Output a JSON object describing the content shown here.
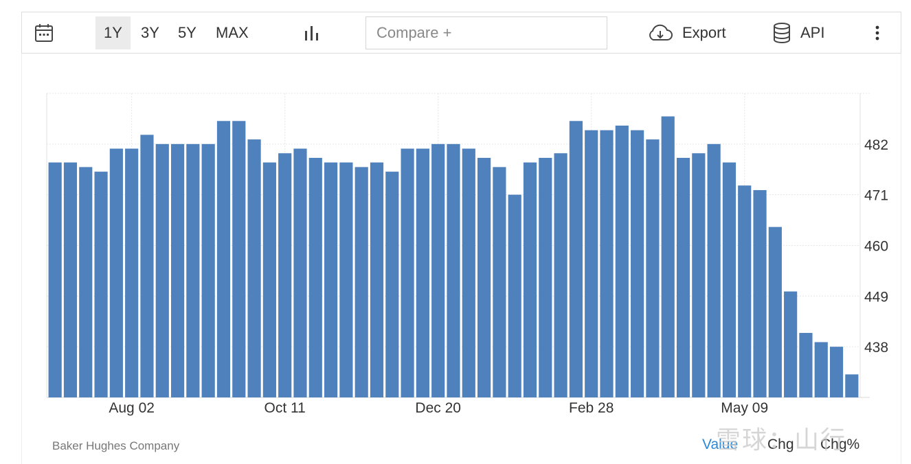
{
  "toolbar": {
    "calendar_icon": "calendar-icon",
    "ranges": [
      "1Y",
      "3Y",
      "5Y",
      "MAX"
    ],
    "active_range": "1Y",
    "chart_type_icon": "bar-chart-icon",
    "compare_placeholder": "Compare +",
    "export_label": "Export",
    "export_icon": "cloud-download-icon",
    "api_label": "API",
    "api_icon": "database-icon",
    "more_icon": "more-vertical-icon"
  },
  "source": "Baker Hughes Company",
  "footer_tabs": {
    "value": "Value",
    "chg": "Chg",
    "chg_pct": "Chg%",
    "active": "Value"
  },
  "watermark": "雪球：山行",
  "colors": {
    "bar": "#4f81bd",
    "active_tab": "#2b88d8",
    "grid": "#e6e6e6"
  },
  "chart_data": {
    "type": "bar",
    "title": "",
    "xlabel": "",
    "ylabel": "",
    "x_tick_labels": [
      "Aug 02",
      "Oct 11",
      "Dec 20",
      "Feb 28",
      "May 09"
    ],
    "y_tick_labels": [
      "438",
      "449",
      "460",
      "471",
      "482"
    ],
    "ylim": [
      427,
      493
    ],
    "grid": true,
    "y_axis_position": "right",
    "values": [
      478,
      478,
      477,
      476,
      481,
      481,
      484,
      482,
      482,
      482,
      482,
      487,
      487,
      483,
      478,
      480,
      481,
      479,
      478,
      478,
      477,
      478,
      476,
      481,
      481,
      482,
      482,
      481,
      479,
      477,
      471,
      478,
      479,
      480,
      487,
      485,
      485,
      486,
      485,
      483,
      488,
      479,
      480,
      482,
      478,
      473,
      472,
      464,
      450,
      441,
      439,
      438,
      432
    ]
  }
}
